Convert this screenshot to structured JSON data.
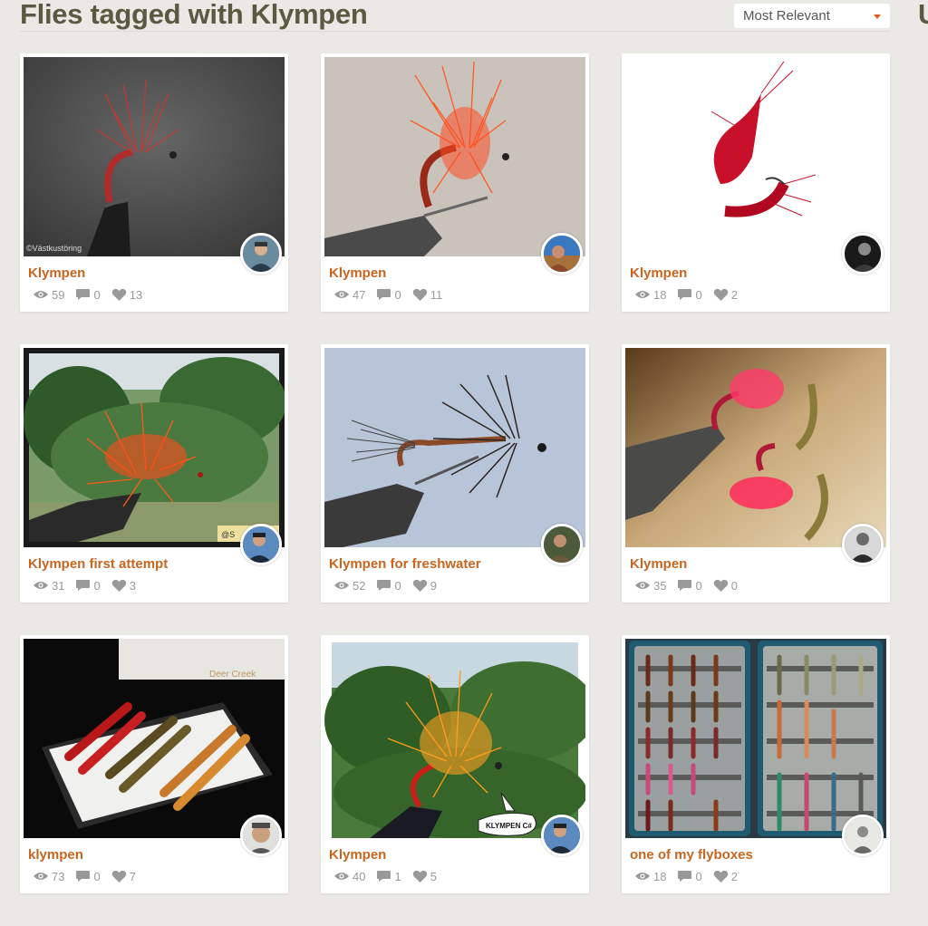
{
  "header": {
    "title": "Flies tagged with Klympen",
    "sort": {
      "selected": "Most Relevant"
    },
    "edge_text": "U"
  },
  "cards": [
    {
      "title": "Klympen",
      "views": "59",
      "comments": "0",
      "likes": "13",
      "watermark": "©Västkustöring"
    },
    {
      "title": "Klympen",
      "views": "47",
      "comments": "0",
      "likes": "11"
    },
    {
      "title": "Klympen",
      "views": "18",
      "comments": "0",
      "likes": "2"
    },
    {
      "title": "Klympen first attempt",
      "views": "31",
      "comments": "0",
      "likes": "3",
      "watermark": "@S"
    },
    {
      "title": "Klympen for freshwater",
      "views": "52",
      "comments": "0",
      "likes": "9"
    },
    {
      "title": "Klympen",
      "views": "35",
      "comments": "0",
      "likes": "0"
    },
    {
      "title": "klympen",
      "views": "73",
      "comments": "0",
      "likes": "7",
      "watermark": "Deer Creek"
    },
    {
      "title": "Klympen",
      "views": "40",
      "comments": "1",
      "likes": "5",
      "watermark": "KLYMPEN C#"
    },
    {
      "title": "one of my flyboxes",
      "views": "18",
      "comments": "0",
      "likes": "2"
    }
  ],
  "icons": {
    "views": "eye-icon",
    "comments": "comment-bubble-icon",
    "likes": "heart-icon",
    "sort": "caret-down-icon"
  },
  "colors": {
    "title": "#5a5a42",
    "card_title": "#c8651e",
    "stats": "#999999",
    "sort_caret": "#d85a1a",
    "background": "#ebe9e6"
  }
}
